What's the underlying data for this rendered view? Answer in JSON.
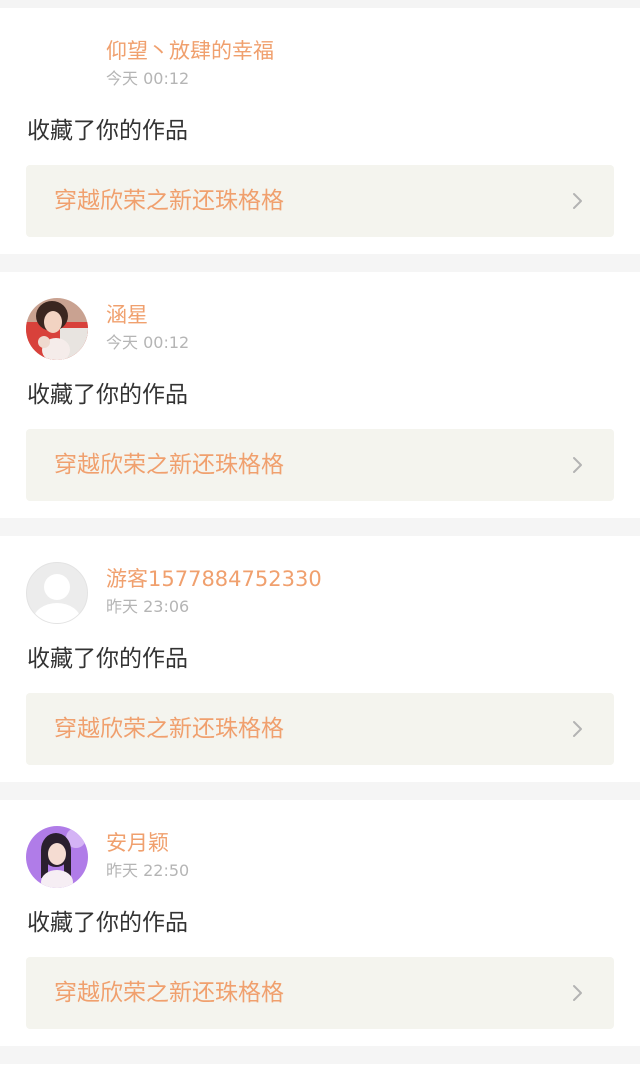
{
  "notifications": [
    {
      "name": "仰望丶放肆的幸福",
      "time": "今天 00:12",
      "action": "收藏了你的作品",
      "work_title": "穿越欣荣之新还珠格格",
      "avatar": "blank"
    },
    {
      "name": "涵星",
      "time": "今天 00:12",
      "action": "收藏了你的作品",
      "work_title": "穿越欣荣之新还珠格格",
      "avatar": "photo-girl-red"
    },
    {
      "name": "游客1577884752330",
      "time": "昨天 23:06",
      "action": "收藏了你的作品",
      "work_title": "穿越欣荣之新还珠格格",
      "avatar": "default-user-icon"
    },
    {
      "name": "安月颖",
      "time": "昨天 22:50",
      "action": "收藏了你的作品",
      "work_title": "穿越欣荣之新还珠格格",
      "avatar": "photo-girl-purple"
    }
  ],
  "colors": {
    "accent": "#f0a06e",
    "action_text": "#333333",
    "time_text": "#b5b5b5",
    "work_box_bg": "#f4f4ee",
    "page_bg": "#f5f5f5"
  },
  "icons": {
    "chevron": "chevron-right-icon"
  }
}
